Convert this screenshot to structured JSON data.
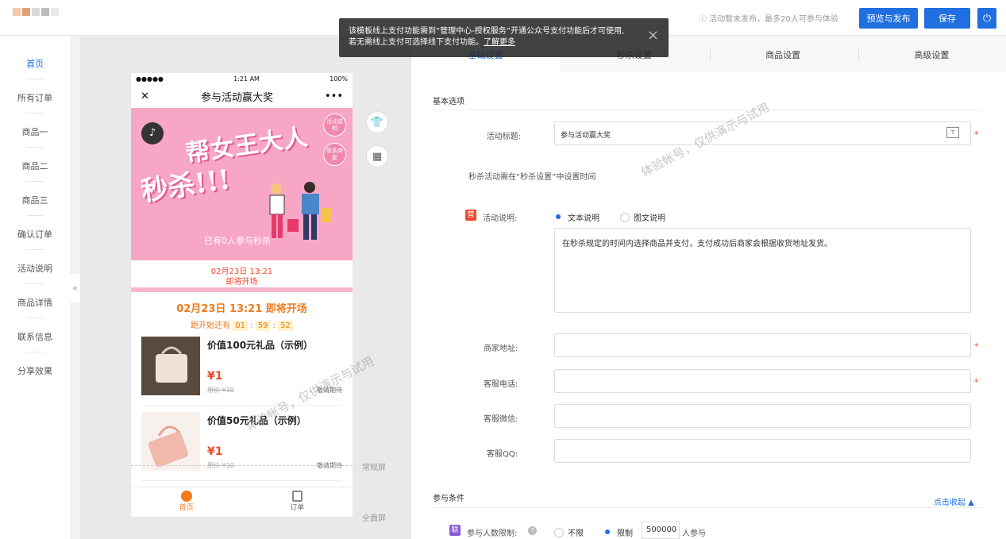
{
  "topbar": {
    "info": "活动暂未发布，最多20人可参与体验",
    "preview_btn": "预览与发布",
    "save_btn": "保存",
    "power_icon": "power-icon"
  },
  "toast": {
    "line1": "该模板线上支付功能需到“管理中心-授权服务”开通公众号支付功能后才可使用,",
    "line2": "若无需线上支付可选择线下支付功能。",
    "link": "了解更多",
    "close": "×"
  },
  "leftnav": {
    "items": [
      "首页",
      "所有订单",
      "商品一",
      "商品二",
      "商品三",
      "确认订单",
      "活动说明",
      "商品详情",
      "联系信息",
      "分享效果"
    ],
    "collapse": "«"
  },
  "phone": {
    "status_left": "●●●●●",
    "status_time": "1:21 AM",
    "status_right": "100%",
    "close": "✕",
    "title": "参与活动赢大奖",
    "more": "•••",
    "banner": {
      "music": "♪",
      "badge1": "活动说明",
      "badge2": "联系商家",
      "headline1": "帮女王大人",
      "headline2": "秒杀!!!",
      "joined": "已有0人参与秒杀"
    },
    "time": {
      "date": "02月23日 13:21",
      "status": "即将开场"
    },
    "countdown_title": "02月23日 13:21 即将开场",
    "countdown_prefix": "距开始还有",
    "countdown_h": "01",
    "countdown_m": "59",
    "countdown_s": "52",
    "products": [
      {
        "name": "价值100元礼品（示例）",
        "price": "¥1",
        "orig": "原价 ¥10",
        "wait": "敬请期待"
      },
      {
        "name": "价值50元礼品（示例）",
        "price": "¥1",
        "orig": "原价 ¥10",
        "wait": "敬请期待"
      }
    ],
    "tabbar": {
      "home": "首页",
      "orders": "订单"
    }
  },
  "preview": {
    "shirt_icon": "shirt-icon",
    "grid_icon": "grid-icon",
    "screen_normal": "常规屏",
    "screen_full": "全面屏",
    "watermark": "体验帐号，仅供演示与试用"
  },
  "tabs": [
    "基础设置",
    "秒杀设置",
    "商品设置",
    "高级设置"
  ],
  "form": {
    "basic_section": "基本选项",
    "title_label": "活动标题:",
    "title_value": "参与活动赢大奖",
    "seckill_hint": "秒杀活动需在“秒杀设置”中设置时间",
    "desc_badge": "营",
    "desc_label": "活动说明:",
    "radio_text": "文本说明",
    "radio_rich": "图文说明",
    "desc_value": "在秒杀规定的时间内选择商品并支付，支付成功后商家会根据收货地址发货。",
    "address_label": "商家地址:",
    "phone_label": "客服电话:",
    "wechat_label": "客服微信:",
    "qq_label": "客服QQ:",
    "required_mark": "*",
    "condition_section": "参与条件",
    "collapse_link": "点击收起 ▲",
    "limit_badge": "联",
    "limit_label": "参与人数限制:",
    "help_icon": "?",
    "radio_unlimited": "不限",
    "radio_limited": "限制",
    "limit_value": "500000",
    "limit_suffix": "人参与"
  }
}
